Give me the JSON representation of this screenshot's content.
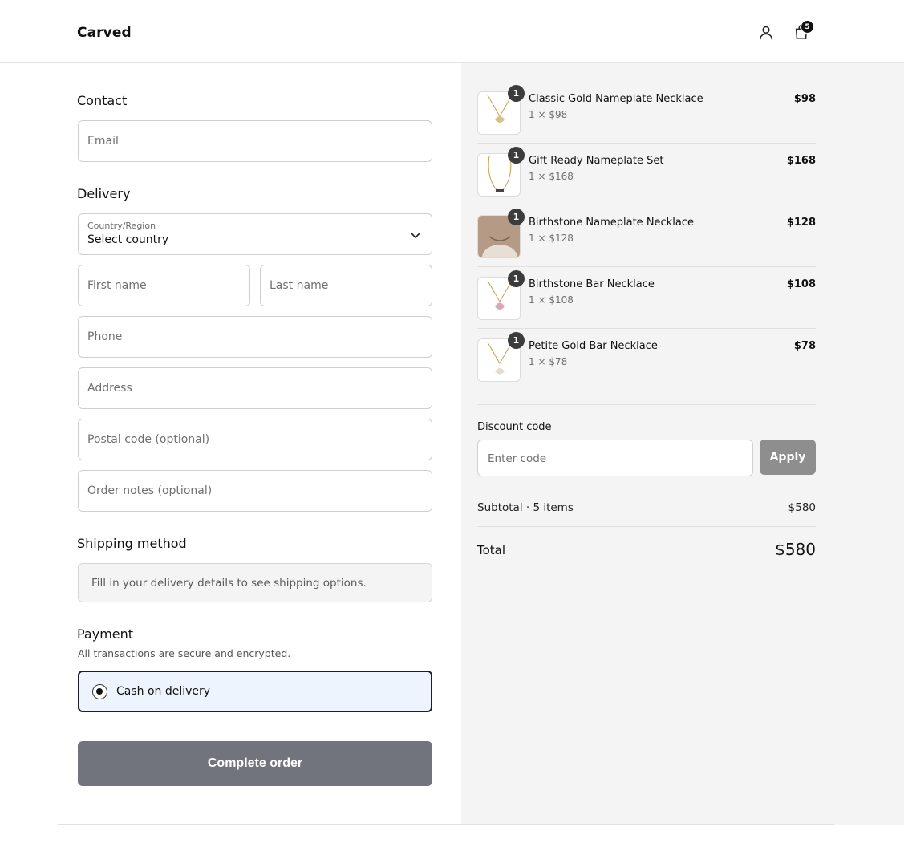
{
  "header": {
    "brand": "Carved",
    "cart_count": "5",
    "account_icon": "user-icon",
    "cart_icon": "shopping-bag-icon"
  },
  "contact": {
    "title": "Contact",
    "email_placeholder": "Email"
  },
  "delivery": {
    "title": "Delivery",
    "country_label": "Country/Region",
    "country_value": "Select country",
    "first_name_placeholder": "First name",
    "last_name_placeholder": "Last name",
    "phone_placeholder": "Phone",
    "address_placeholder": "Address",
    "postal_placeholder": "Postal code (optional)",
    "notes_placeholder": "Order notes (optional)"
  },
  "shipping": {
    "title": "Shipping method",
    "message": "Fill in your delivery details to see shipping options."
  },
  "payment": {
    "title": "Payment",
    "subtitle": "All transactions are secure and encrypted.",
    "option_label": "Cash on delivery"
  },
  "complete_button": "Complete order",
  "summary": {
    "items": [
      {
        "name": "Classic Gold Nameplate Necklace",
        "qty": "1",
        "meta": "1 × $98",
        "price": "$98"
      },
      {
        "name": "Gift Ready Nameplate Set",
        "qty": "1",
        "meta": "1 × $168",
        "price": "$168"
      },
      {
        "name": "Birthstone Nameplate Necklace",
        "qty": "1",
        "meta": "1 × $128",
        "price": "$128"
      },
      {
        "name": "Birthstone Bar Necklace",
        "qty": "1",
        "meta": "1 × $108",
        "price": "$108"
      },
      {
        "name": "Petite Gold Bar Necklace",
        "qty": "1",
        "meta": "1 × $78",
        "price": "$78"
      }
    ],
    "discount_label": "Discount code",
    "discount_placeholder": "Enter code",
    "apply_label": "Apply",
    "subtotal_label": "Subtotal · 5 items",
    "subtotal_value": "$580",
    "total_label": "Total",
    "total_value": "$580"
  },
  "colors": {
    "complete_button": "#71747c",
    "apply_button": "#8e8e8e",
    "payment_selected_bg": "#eef4fd",
    "summary_bg": "#f4f4f4"
  }
}
